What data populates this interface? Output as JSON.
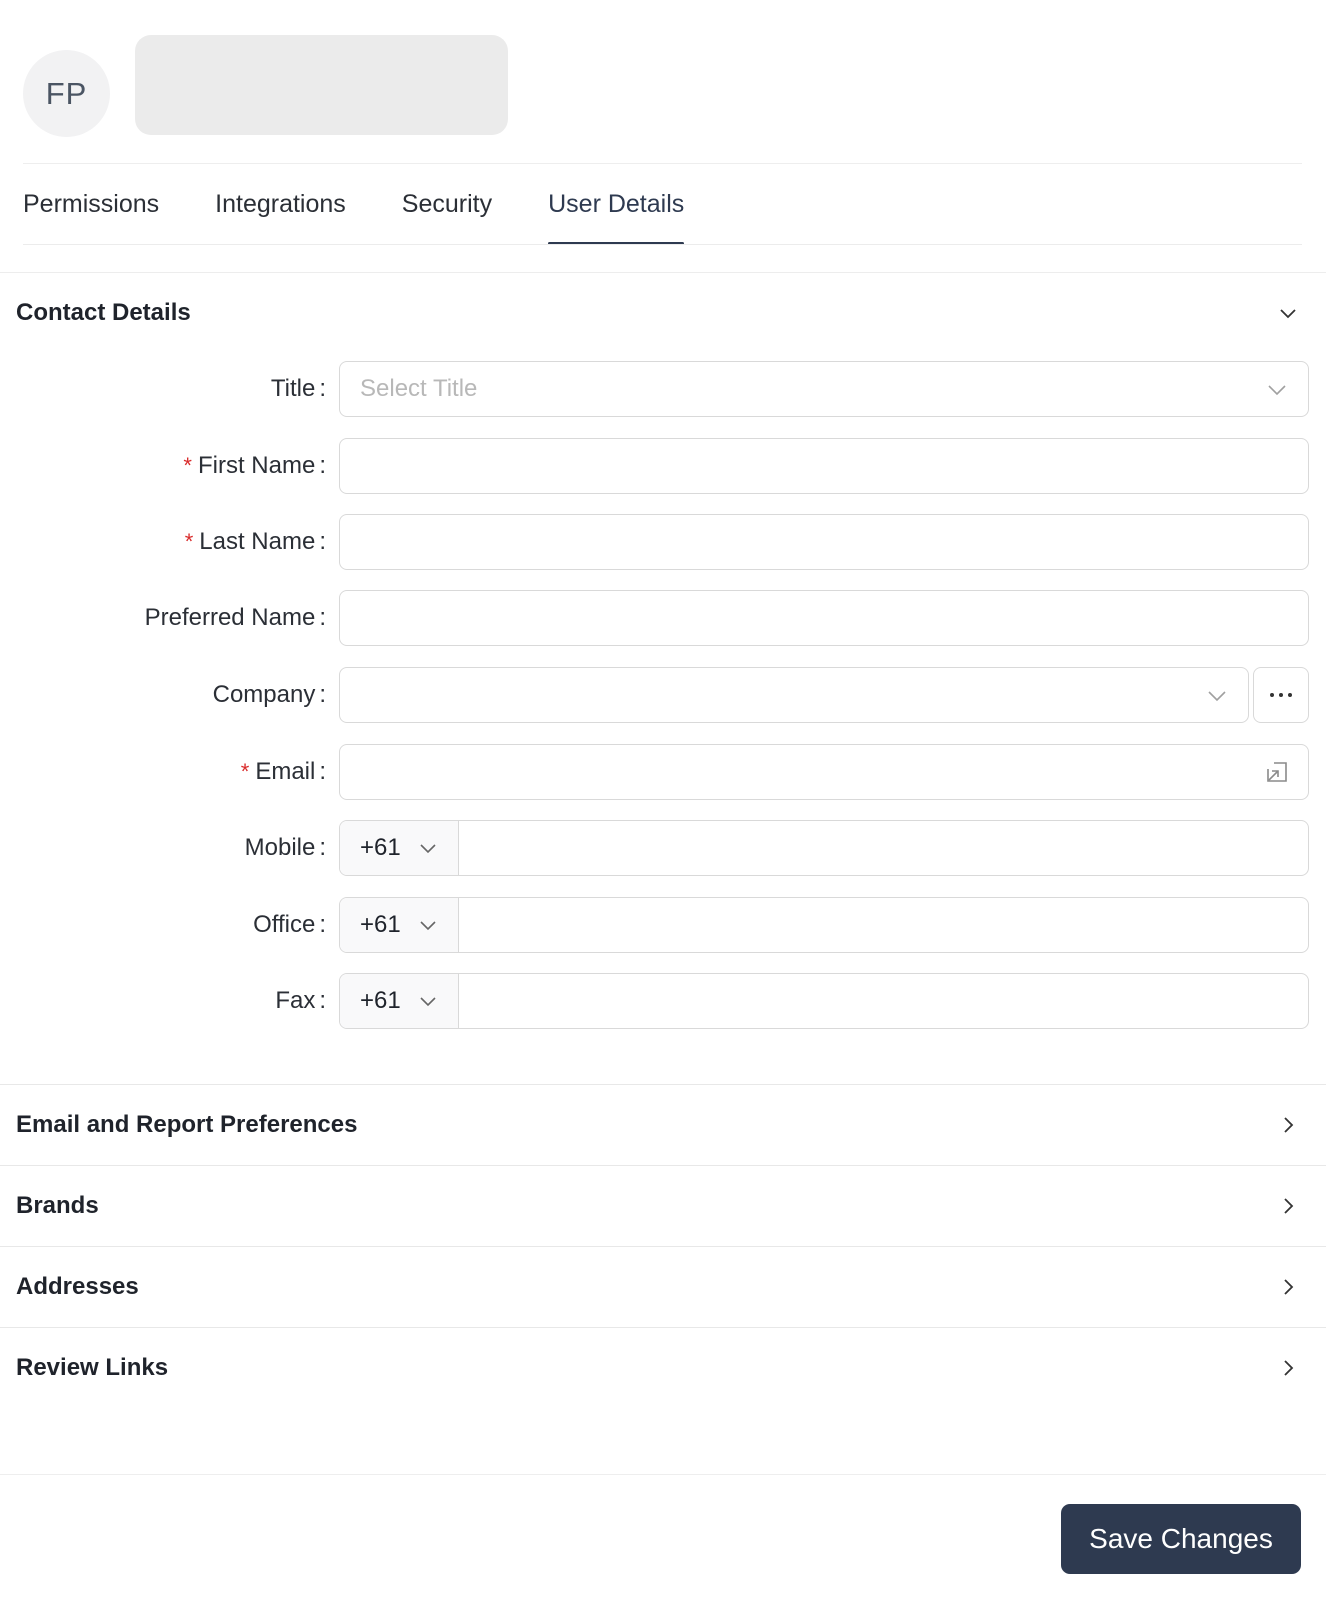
{
  "header": {
    "avatar_initials": "FP"
  },
  "tabs": [
    {
      "label": "Permissions"
    },
    {
      "label": "Integrations"
    },
    {
      "label": "Security"
    },
    {
      "label": "User Details",
      "active": true
    }
  ],
  "contact_details": {
    "title": "Contact Details",
    "fields": {
      "title": {
        "label": "Title",
        "placeholder": "Select Title",
        "value": ""
      },
      "first_name": {
        "label": "First Name",
        "required": true,
        "value": ""
      },
      "last_name": {
        "label": "Last Name",
        "required": true,
        "value": ""
      },
      "preferred_name": {
        "label": "Preferred Name",
        "value": ""
      },
      "company": {
        "label": "Company",
        "value": ""
      },
      "email": {
        "label": "Email",
        "required": true,
        "value": ""
      },
      "mobile": {
        "label": "Mobile",
        "country_code": "+61",
        "value": ""
      },
      "office": {
        "label": "Office",
        "country_code": "+61",
        "value": ""
      },
      "fax": {
        "label": "Fax",
        "country_code": "+61",
        "value": ""
      }
    },
    "required_marker": "*"
  },
  "sections": [
    {
      "title": "Email and Report Preferences"
    },
    {
      "title": "Brands"
    },
    {
      "title": "Addresses"
    },
    {
      "title": "Review Links"
    }
  ],
  "footer": {
    "save_label": "Save Changes"
  },
  "colors": {
    "accent": "#2e3a50",
    "required": "#d92b2b",
    "border": "#d9d9d9",
    "placeholder": "#b8b8b8"
  },
  "icons": {
    "collapse": "chevron-down-icon",
    "expand": "chevron-right-icon",
    "more": "ellipsis-icon",
    "email_action": "open-link-icon"
  }
}
